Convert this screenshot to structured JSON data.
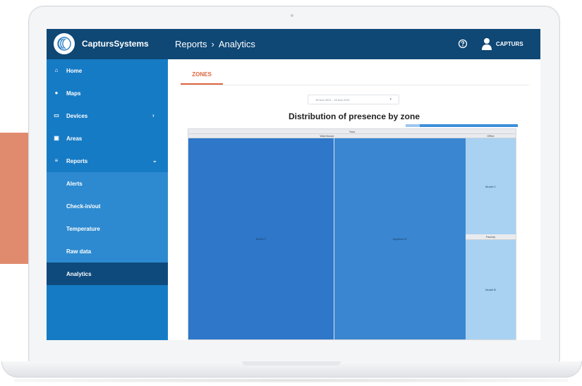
{
  "header": {
    "brand": "CaptursSystems",
    "breadcrumb": {
      "section": "Reports",
      "separator": "›",
      "page": "Analytics"
    },
    "user": "CAPTURS"
  },
  "sidebar": {
    "items": [
      {
        "label": "Home",
        "icon": "home-icon",
        "glyph": "⌂"
      },
      {
        "label": "Maps",
        "icon": "map-pin-icon",
        "glyph": "●"
      },
      {
        "label": "Devices",
        "icon": "devices-icon",
        "glyph": "▭",
        "chevron": "›"
      },
      {
        "label": "Areas",
        "icon": "areas-icon",
        "glyph": "▣"
      },
      {
        "label": "Reports",
        "icon": "reports-icon",
        "glyph": "≡",
        "chevron": "⌄"
      }
    ],
    "subitems": [
      {
        "label": "Alerts"
      },
      {
        "label": "Check-in/out"
      },
      {
        "label": "Temperature"
      },
      {
        "label": "Raw data"
      },
      {
        "label": "Analytics",
        "active": true
      }
    ]
  },
  "main": {
    "tab": "ZONES",
    "date_range": "18 Nov 2021 - 18 Nov 2021",
    "date_caret": "▾",
    "chart_title": "Distribution of presence by zone"
  },
  "chart_data": {
    "type": "treemap",
    "root": "Tous",
    "groups": [
      {
        "name": "Warehouse",
        "children": [
          {
            "name": "Model F",
            "color": "#2e77c9"
          },
          {
            "name": "Applicat xC",
            "color": "#3a86d0"
          }
        ]
      },
      {
        "name": "Office",
        "children": [
          {
            "name": "Model C",
            "color": "#a9d1f1"
          }
        ]
      },
      {
        "name": "Factory",
        "children": [
          {
            "name": "Model B",
            "color": "#a9d1f1"
          }
        ]
      }
    ]
  },
  "colors": {
    "header_bg": "#0f4775",
    "sidebar_bg": "#167bc5",
    "sidebar_sub_bg": "#2d8ad0",
    "sidebar_active": "#0e4a7c",
    "accent": "#e0663e"
  }
}
